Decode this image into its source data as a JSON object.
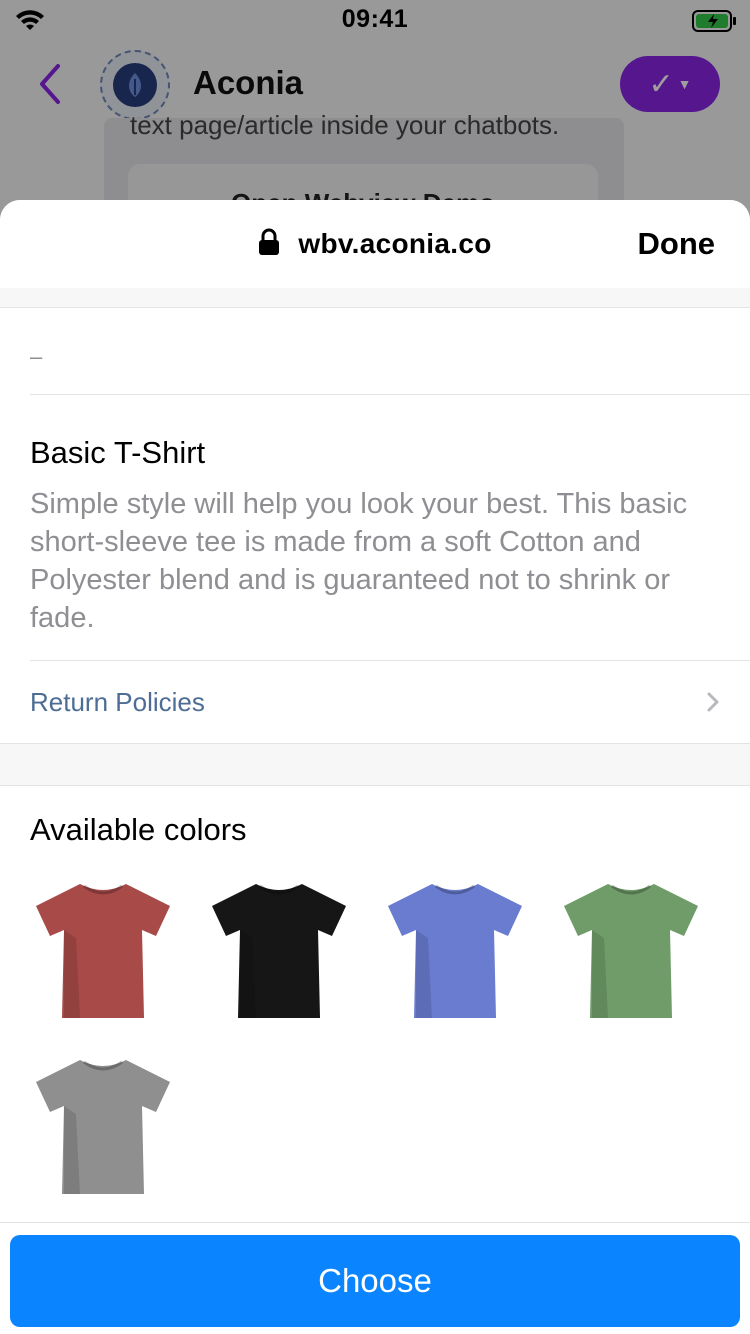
{
  "status_bar": {
    "time": "09:41"
  },
  "chat": {
    "bot_name": "Aconia",
    "action_label": "✓",
    "card_text": "text page/article inside your chatbots.",
    "card_button": "Open Webview Demo"
  },
  "webview": {
    "url": "wbv.aconia.co",
    "done_label": "Done"
  },
  "product": {
    "price": "–",
    "title": "Basic T-Shirt",
    "description": "Simple style will help you look your best. This basic short-sleeve tee is made from a soft Cotton and Polyester blend and is guaranteed not to shrink or fade.",
    "return_policies_label": "Return Policies"
  },
  "colors_section": {
    "title": "Available colors",
    "swatches": [
      {
        "name": "red",
        "hex": "#a74a48"
      },
      {
        "name": "black",
        "hex": "#161616"
      },
      {
        "name": "blue",
        "hex": "#6a7cd0"
      },
      {
        "name": "green",
        "hex": "#6f9c69"
      },
      {
        "name": "gray",
        "hex": "#8f8f8f"
      }
    ]
  },
  "footer": {
    "choose_label": "Choose"
  },
  "theme": {
    "accent": "#0a84ff",
    "link": "#4d6d95",
    "purple": "#8a25e6"
  }
}
